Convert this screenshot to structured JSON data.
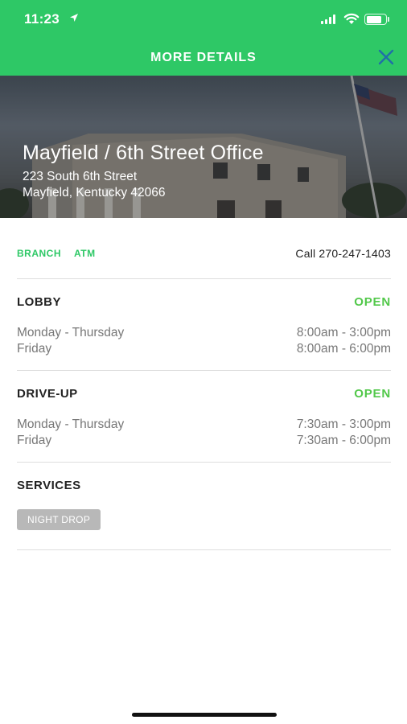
{
  "status_bar": {
    "time": "11:23"
  },
  "header": {
    "title": "MORE DETAILS"
  },
  "location": {
    "name": "Mayfield / 6th Street Office",
    "address_line1": "223 South 6th Street",
    "address_line2": "Mayfield, Kentucky 42066"
  },
  "tags": [
    "BRANCH",
    "ATM"
  ],
  "call_label": "Call 270-247-1403",
  "lobby": {
    "title": "LOBBY",
    "status": "OPEN",
    "hours": [
      {
        "day": "Monday - Thursday",
        "time": "8:00am - 3:00pm"
      },
      {
        "day": "Friday",
        "time": "8:00am - 6:00pm"
      }
    ]
  },
  "driveup": {
    "title": "DRIVE-UP",
    "status": "OPEN",
    "hours": [
      {
        "day": "Monday - Thursday",
        "time": "7:30am - 3:00pm"
      },
      {
        "day": "Friday",
        "time": "7:30am - 6:00pm"
      }
    ]
  },
  "services": {
    "title": "SERVICES",
    "items": [
      "NIGHT DROP"
    ]
  },
  "colors": {
    "brand_green": "#2ec866",
    "open_green": "#52c84a",
    "chip_gray": "#b8b8b8"
  }
}
